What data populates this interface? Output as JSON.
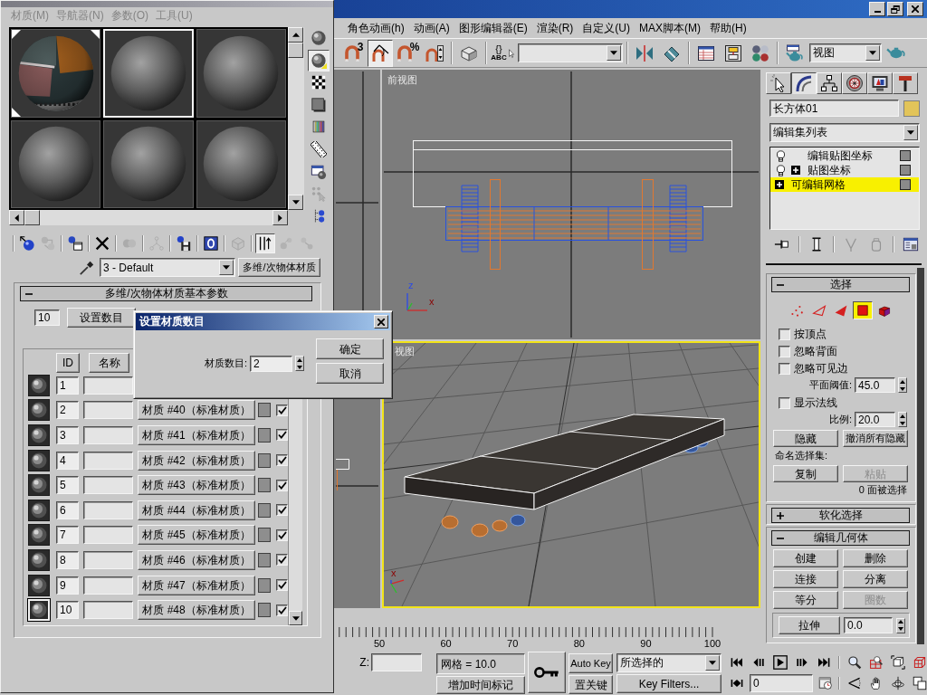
{
  "material_editor": {
    "menu": [
      {
        "label": "材质(M)",
        "disabled": true
      },
      {
        "label": "导航器(N)",
        "disabled": true
      },
      {
        "label": "参数(O)",
        "disabled": true
      },
      {
        "label": "工具(U)",
        "disabled": true
      }
    ],
    "sample_slots": [
      {
        "kind": "textured",
        "selected": false,
        "in_scene": true
      },
      {
        "kind": "plain",
        "selected": true,
        "in_scene": false
      },
      {
        "kind": "plain",
        "selected": false,
        "in_scene": false
      },
      {
        "kind": "plain",
        "selected": false,
        "in_scene": false
      },
      {
        "kind": "plain",
        "selected": false,
        "in_scene": false
      },
      {
        "kind": "plain",
        "selected": false,
        "in_scene": false
      }
    ],
    "side_tools": [
      {
        "kind": "sample_type",
        "pressed": false,
        "disabled": false
      },
      {
        "kind": "backlight",
        "pressed": true,
        "disabled": false
      },
      {
        "kind": "background",
        "pressed": false,
        "disabled": false
      },
      {
        "kind": "uv_tiling",
        "pressed": false,
        "disabled": false
      },
      {
        "kind": "video_check",
        "pressed": false,
        "disabled": false
      },
      {
        "kind": "make_preview",
        "pressed": false,
        "disabled": false
      },
      {
        "kind": "options",
        "pressed": false,
        "disabled": false
      },
      {
        "kind": "select_by_material",
        "pressed": false,
        "disabled": true
      },
      {
        "kind": "navigator",
        "pressed": false,
        "disabled": false
      }
    ],
    "bottom_tools": [
      {
        "kind": "separator"
      },
      {
        "kind": "get_material",
        "pressed": false,
        "disabled": false
      },
      {
        "kind": "put_to_scene",
        "pressed": false,
        "disabled": true
      },
      {
        "kind": "separator"
      },
      {
        "kind": "assign",
        "pressed": false,
        "disabled": false
      },
      {
        "kind": "separator"
      },
      {
        "kind": "reset",
        "pressed": false,
        "disabled": false
      },
      {
        "kind": "separator"
      },
      {
        "kind": "make_copy",
        "pressed": false,
        "disabled": true
      },
      {
        "kind": "separator"
      },
      {
        "kind": "make_unique",
        "pressed": false,
        "disabled": true
      },
      {
        "kind": "separator"
      },
      {
        "kind": "put_to_library",
        "pressed": false,
        "disabled": false
      },
      {
        "kind": "separator"
      },
      {
        "kind": "effects_channel",
        "pressed": false,
        "disabled": false
      },
      {
        "kind": "separator"
      },
      {
        "kind": "show_map",
        "pressed": false,
        "disabled": true
      },
      {
        "kind": "separator"
      },
      {
        "kind": "show_end_result",
        "pressed": true,
        "disabled": false
      },
      {
        "kind": "go_to_parent",
        "pressed": false,
        "disabled": true
      },
      {
        "kind": "go_forward",
        "pressed": false,
        "disabled": true
      }
    ],
    "material_name": "3 - Default",
    "material_type": "多维/次物体材质",
    "parameters": {
      "title": "多维/次物体材质基本参数",
      "expanded": true,
      "count": "10",
      "set_count": "设置数目",
      "columns": [
        "ID",
        "名称"
      ],
      "rows": [
        {
          "id": "1",
          "selected": false
        },
        {
          "id": "2",
          "sub_material": "材质 #40（标准材质）",
          "enabled": true,
          "selected": false
        },
        {
          "id": "3",
          "sub_material": "材质 #41（标准材质）",
          "enabled": true,
          "selected": false
        },
        {
          "id": "4",
          "sub_material": "材质 #42（标准材质）",
          "enabled": true,
          "selected": false
        },
        {
          "id": "5",
          "sub_material": "材质 #43（标准材质）",
          "enabled": true,
          "selected": false
        },
        {
          "id": "6",
          "sub_material": "材质 #44（标准材质）",
          "enabled": true,
          "selected": false
        },
        {
          "id": "7",
          "sub_material": "材质 #45（标准材质）",
          "enabled": true,
          "selected": false
        },
        {
          "id": "8",
          "sub_material": "材质 #46（标准材质）",
          "enabled": true,
          "selected": false
        },
        {
          "id": "9",
          "sub_material": "材质 #47（标准材质）",
          "enabled": true,
          "selected": false
        },
        {
          "id": "10",
          "sub_material": "材质 #48（标准材质）",
          "enabled": true,
          "selected": true
        }
      ]
    }
  },
  "dialog": {
    "title": "设置材质数目",
    "label": "材质数目:",
    "value": "2",
    "buttons": [
      "确定",
      "取消"
    ]
  },
  "main_window": {
    "menu": [
      "角色动画(h)",
      "动画(A)",
      "图形编辑器(E)",
      "渲染(R)",
      "自定义(U)",
      "MAX脚本(M)",
      "帮助(H)"
    ],
    "toolbar": [
      {
        "kind": "snap",
        "badge": "3",
        "pressed": false
      },
      {
        "kind": "angle_snap",
        "pressed": true
      },
      {
        "kind": "percent_snap",
        "badge": "%",
        "pressed": false
      },
      {
        "kind": "spinner_snap",
        "pressed": false
      },
      {
        "kind": "separator"
      },
      {
        "kind": "shortcut_override",
        "pressed": false
      },
      {
        "kind": "separator"
      },
      {
        "kind": "named_sets",
        "badge": "{}",
        "caption": "ABC",
        "pressed": false
      },
      {
        "kind": "named_selection_dropdown"
      },
      {
        "kind": "separator"
      },
      {
        "kind": "mirror",
        "pressed": false
      },
      {
        "kind": "align",
        "pressed": false
      },
      {
        "kind": "separator"
      },
      {
        "kind": "track_view",
        "pressed": false
      },
      {
        "kind": "schematic",
        "pressed": false
      },
      {
        "kind": "material_editor",
        "pressed": false
      },
      {
        "kind": "separator"
      },
      {
        "kind": "render_scene",
        "pressed": false
      },
      {
        "kind": "render_dropdown",
        "value": "视图"
      },
      {
        "kind": "quick_render",
        "pressed": false
      }
    ],
    "viewports": [
      {
        "kind": "top",
        "active": false
      },
      {
        "kind": "front",
        "label": "前视图",
        "active": false,
        "axes": [
          "z",
          "x"
        ]
      },
      {
        "kind": "left",
        "active": false
      },
      {
        "kind": "perspective",
        "label": "视图",
        "active": true,
        "axes": [
          "x"
        ]
      }
    ],
    "timeline": {
      "labels": [
        "50",
        "60",
        "70",
        "80",
        "90",
        "100"
      ]
    }
  },
  "command_panel": {
    "tabs": [
      {
        "kind": "create",
        "selected": false
      },
      {
        "kind": "modify",
        "selected": true
      },
      {
        "kind": "hierarchy",
        "selected": false
      },
      {
        "kind": "motion",
        "selected": false
      },
      {
        "kind": "display",
        "selected": false
      },
      {
        "kind": "utilities",
        "selected": false
      }
    ],
    "object_name": "长方体01",
    "modifier_list": "编辑集列表",
    "stack": [
      {
        "kind": "modifier",
        "label": "编辑贴图坐标",
        "expandable": false,
        "selected": false
      },
      {
        "kind": "modifier",
        "label": "贴图坐标",
        "expandable": true,
        "selected": false
      },
      {
        "kind": "object",
        "label": "可编辑网格",
        "expandable": true,
        "selected": true
      }
    ],
    "stack_tools": [
      {
        "kind": "pin",
        "disabled": false
      },
      {
        "kind": "separator"
      },
      {
        "kind": "show_end_result",
        "disabled": false
      },
      {
        "kind": "separator"
      },
      {
        "kind": "make_unique",
        "disabled": true
      },
      {
        "kind": "remove_modifier",
        "disabled": true
      },
      {
        "kind": "separator"
      },
      {
        "kind": "configure",
        "disabled": false
      }
    ],
    "rollouts": [
      {
        "kind": "selection",
        "title": "选择",
        "expanded": true,
        "levels": [
          {
            "kind": "vertex",
            "selected": false
          },
          {
            "kind": "edge",
            "selected": false
          },
          {
            "kind": "face",
            "selected": false
          },
          {
            "kind": "polygon",
            "selected": true
          },
          {
            "kind": "element",
            "selected": false
          }
        ],
        "options": [
          {
            "label": "按顶点",
            "checked": false
          },
          {
            "label": "忽略背面",
            "checked": false
          },
          {
            "label": "忽略可见边",
            "checked": false
          }
        ],
        "planar_threshold": {
          "label": "平面阈值:",
          "value": "45.0"
        },
        "show_normals": {
          "label": "显示法线",
          "checked": false
        },
        "scale": {
          "label": "比例:",
          "value": "20.0"
        },
        "hide_buttons": [
          {
            "label": "隐藏",
            "disabled": false
          },
          {
            "label": "撤消所有隐藏",
            "disabled": false
          }
        ],
        "named_sets_label": "命名选择集:",
        "named_set_buttons": [
          {
            "label": "复制",
            "disabled": false
          },
          {
            "label": "粘贴",
            "disabled": true
          }
        ],
        "status": "0 面被选择"
      },
      {
        "kind": "soft_selection",
        "title": "软化选择",
        "expanded": false
      },
      {
        "kind": "edit_geometry",
        "title": "编辑几何体",
        "expanded": true,
        "buttons": [
          {
            "label": "创建",
            "disabled": false
          },
          {
            "label": "删除",
            "disabled": false
          },
          {
            "label": "连接",
            "disabled": false
          },
          {
            "label": "分离",
            "disabled": false
          },
          {
            "label": "等分",
            "disabled": false
          },
          {
            "label": "圈数",
            "disabled": true
          }
        ],
        "extrude": {
          "label": "拉伸",
          "value": "0.0"
        }
      }
    ]
  },
  "status_bar": {
    "z_label": "Z:",
    "grid_spacing": "网格 = 10.0",
    "add_time_tag": "增加时间标记",
    "auto_key": {
      "label": "Auto Key",
      "on": false
    },
    "set_key": "置关键",
    "selection_filter": "所选择的",
    "key_filters": "Key Filters...",
    "playback": [
      {
        "kind": "go_to_start"
      },
      {
        "kind": "previous_frame"
      },
      {
        "kind": "play"
      },
      {
        "kind": "next_frame"
      },
      {
        "kind": "go_to_end"
      }
    ],
    "frame_row": [
      {
        "kind": "key_mode"
      },
      {
        "kind": "frame_field",
        "value": "0"
      },
      {
        "kind": "time_config"
      }
    ],
    "navigation": [
      {
        "kind": "zoom"
      },
      {
        "kind": "zoom_all"
      },
      {
        "kind": "zoom_extents"
      },
      {
        "kind": "zoom_extents_all"
      },
      {
        "kind": "field_of_view"
      },
      {
        "kind": "pan"
      },
      {
        "kind": "orbit"
      },
      {
        "kind": "maximize"
      }
    ]
  }
}
